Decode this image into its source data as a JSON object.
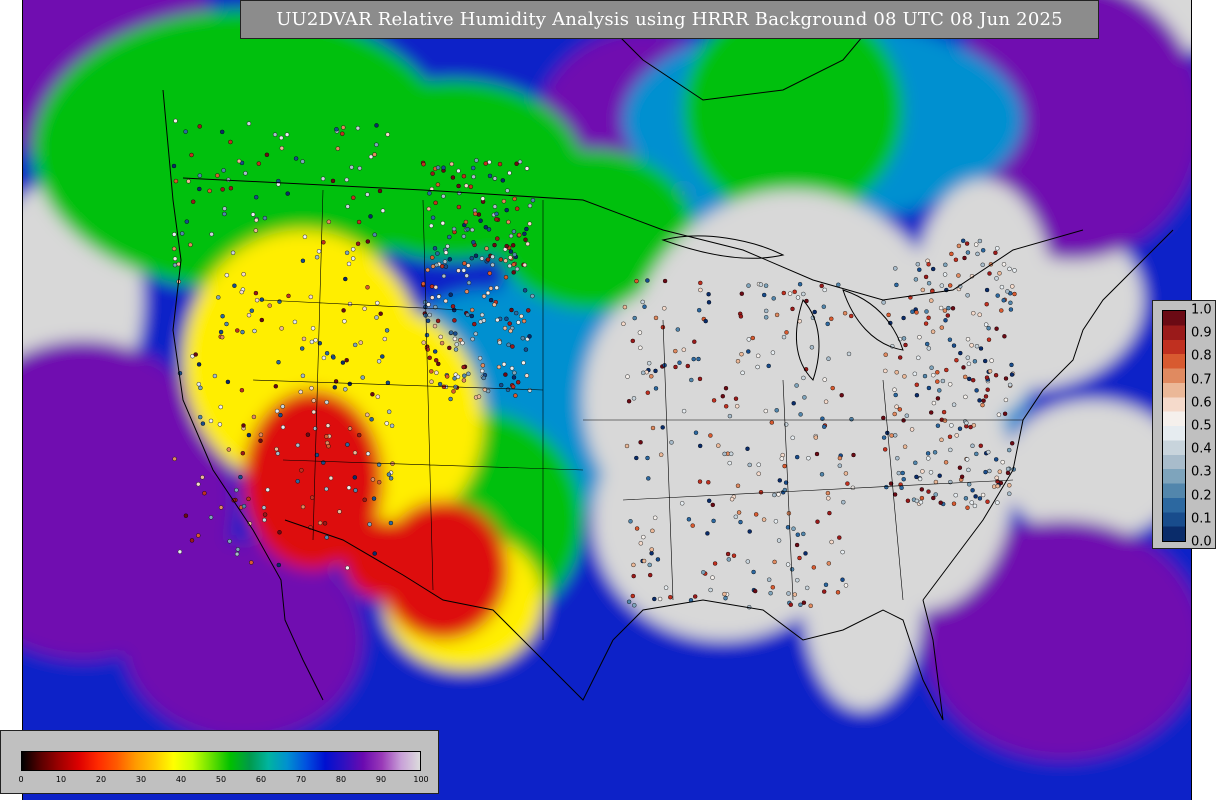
{
  "title": "UU2DVAR Relative Humidity Analysis using HRRR Background 08 UTC 08 Jun 2025",
  "rh_colorbar": {
    "tick_labels": [
      "0",
      "10",
      "20",
      "30",
      "40",
      "50",
      "60",
      "70",
      "80",
      "90",
      "100"
    ],
    "colors": [
      "#000000",
      "#5a0000",
      "#a00000",
      "#dd0000",
      "#ff2a00",
      "#ff5a00",
      "#ff9a00",
      "#ffc800",
      "#ffff00",
      "#c8ff00",
      "#66e000",
      "#00c000",
      "#009a4a",
      "#00b4a0",
      "#0090d0",
      "#0050e0",
      "#0010d0",
      "#3010c0",
      "#6a0ab0",
      "#9a3ab8",
      "#c8a0d8",
      "#dcdcdc"
    ]
  },
  "ratio_colorbar": {
    "tick_labels": [
      "1.0",
      "0.9",
      "0.8",
      "0.7",
      "0.6",
      "0.5",
      "0.4",
      "0.3",
      "0.2",
      "0.1",
      "0.0"
    ],
    "colors": [
      "#6b0a14",
      "#9a1a1a",
      "#c03020",
      "#d85a30",
      "#e08a60",
      "#ebb898",
      "#f5dacb",
      "#f5f0ec",
      "#e6ecf0",
      "#c8d4dc",
      "#a8bccb",
      "#7ea4bc",
      "#5286ac",
      "#2c68a0",
      "#184c8c",
      "#0a2c6a"
    ]
  },
  "map_colors": {
    "ocean_moist": "#1020c8",
    "saturated": "#d8d8d8",
    "dry": "#dd1010",
    "semi_dry": "#ffee00",
    "moderate": "#00c010",
    "humid": "#0090d0",
    "very_humid": "#7010b0"
  }
}
